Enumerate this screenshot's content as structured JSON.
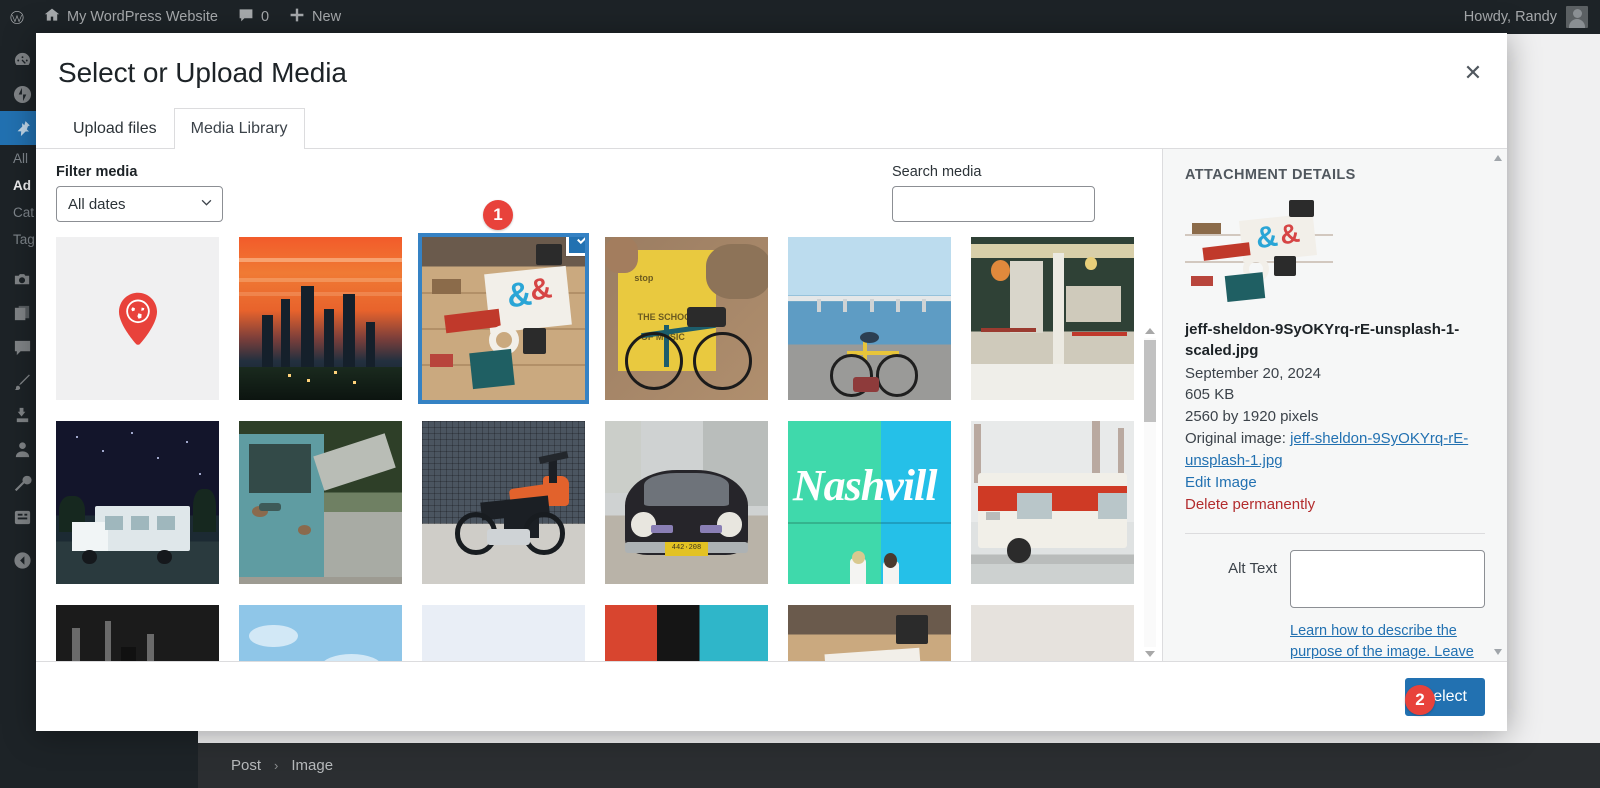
{
  "adminbar": {
    "logo_icon": "wordpress-logo-icon",
    "home_icon": "home-icon",
    "site_name": "My WordPress Website",
    "comments_icon": "comment-bubble-icon",
    "comments_count": "0",
    "new_icon": "plus-icon",
    "new_label": "New",
    "howdy": "Howdy, Randy",
    "avatar_icon": "user-avatar"
  },
  "sidebar": {
    "items": [
      {
        "icon": "dashboard-icon",
        "label": ""
      },
      {
        "icon": "jetpack-icon",
        "label": ""
      },
      {
        "icon": "pin-posts-icon",
        "label": "",
        "current": true
      }
    ],
    "submenu": [
      {
        "label": "All",
        "active": false
      },
      {
        "label": "Ad",
        "active": true
      },
      {
        "label": "Cat",
        "active": false
      },
      {
        "label": "Tag",
        "active": false
      }
    ],
    "items2": [
      {
        "icon": "media-camera-icon"
      },
      {
        "icon": "pages-icon"
      },
      {
        "icon": "comments-icon"
      },
      {
        "icon": "appearance-brush-icon"
      },
      {
        "icon": "plugins-plug-icon"
      },
      {
        "icon": "users-icon"
      },
      {
        "icon": "tools-wrench-icon"
      },
      {
        "icon": "settings-sliders-icon"
      },
      {
        "icon": "collapse-menu-icon"
      }
    ]
  },
  "breadcrumb": {
    "parent": "Post",
    "separator": "›",
    "current": "Image"
  },
  "modal": {
    "title": "Select or Upload Media",
    "close_icon": "close-x-icon",
    "tabs": [
      {
        "label": "Upload files",
        "active": false
      },
      {
        "label": "Media Library",
        "active": true
      }
    ],
    "filter_label": "Filter media",
    "filter_value": "All dates",
    "filter_options": [
      "All dates"
    ],
    "filter_chevron_icon": "chevron-down-icon",
    "search_label": "Search media",
    "search_value": "",
    "select_button": "Select"
  },
  "grid": {
    "items": [
      {
        "name": "map-pin-placeholder",
        "art": "ph-globe",
        "selected": false
      },
      {
        "name": "city-sunset-skyline",
        "art": "sc-sunset",
        "selected": false
      },
      {
        "name": "desk-flatlay-ampersand",
        "art": "sc-desk",
        "selected": true
      },
      {
        "name": "bicycle-yellow-wall",
        "art": "sc-bikeyellow",
        "selected": false
      },
      {
        "name": "bicycle-bridge-waterfront",
        "art": "sc-bridge",
        "selected": false
      },
      {
        "name": "cafe-storefront-bicycles",
        "art": "sc-cafe",
        "selected": false
      },
      {
        "name": "campervan-night-sky",
        "art": "sc-rvnight",
        "selected": false
      },
      {
        "name": "vintage-truck-open-hood",
        "art": "sc-truck",
        "selected": false
      },
      {
        "name": "orange-electric-motorcycle",
        "art": "sc-moto",
        "selected": false
      },
      {
        "name": "karmann-ghia-classic-car",
        "art": "sc-car",
        "selected": false
      },
      {
        "name": "nashville-mural-wall",
        "art": "sc-nash",
        "selected": false
      },
      {
        "name": "red-white-vintage-rv",
        "art": "sc-rvred",
        "selected": false
      },
      {
        "name": "blackwhite-street-bike",
        "art": "sc-bw",
        "selected": false
      },
      {
        "name": "motorcycle-against-sky",
        "art": "sc-motosky",
        "selected": false
      },
      {
        "name": "pale-minimal-object",
        "art": "sc-pale",
        "selected": false
      },
      {
        "name": "yellow-car-blue-door",
        "art": "sc-yellowcar",
        "selected": false
      },
      {
        "name": "desk-flatlay-duplicate",
        "art": "sc-desk",
        "selected": false
      },
      {
        "name": "glass-bowl-neutral",
        "art": "sc-bowl",
        "selected": false
      }
    ],
    "selected_badge_icon": "checkmark-icon"
  },
  "details": {
    "heading": "ATTACHMENT DETAILS",
    "thumbnail_icon": "attachment-thumbnail",
    "filename": "jeff-sheldon-9SyOKYrq-rE-unsplash-1-scaled.jpg",
    "date": "September 20, 2024",
    "filesize": "605 KB",
    "dimensions": "2560 by 1920 pixels",
    "original_label": "Original image:",
    "original_link": "jeff-sheldon-9SyOKYrq-rE-unsplash-1.jpg",
    "edit_image": "Edit Image",
    "delete_permanently": "Delete permanently",
    "alt_label": "Alt Text",
    "alt_value": "",
    "alt_help_line1": "Learn how to describe the",
    "alt_help_line2": "purpose of the image. Leave"
  },
  "steps": [
    {
      "number": "1"
    },
    {
      "number": "2"
    }
  ],
  "colors": {
    "wp_blue": "#2271b1",
    "select_outline": "#3582c4",
    "step_red": "#e8423b",
    "danger_red": "#b32d2e",
    "admin_dark": "#1d2327"
  }
}
